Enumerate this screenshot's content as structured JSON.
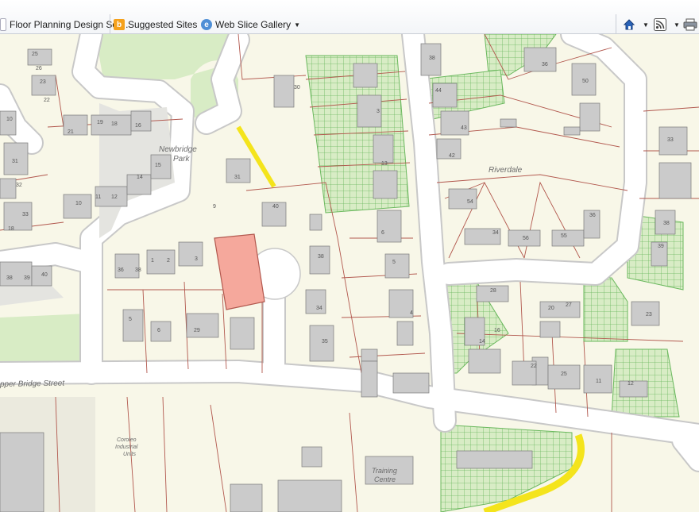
{
  "toolbar": {
    "tab_title": "Floor Planning Design Sof...",
    "suggested_sites": "Suggested Sites",
    "web_slice_gallery": "Web Slice Gallery"
  },
  "map": {
    "labels": {
      "newbridge_1": "Newbridge",
      "newbridge_2": "Park",
      "riverdale": "Riverdale",
      "street": "pper Bridge Street",
      "industrial_1": "Coroleo",
      "industrial_2": "Industrial",
      "industrial_3": "Units",
      "training_1": "Training",
      "training_2": "Centre"
    },
    "house_numbers": [
      "25",
      "26",
      "23",
      "22",
      "10",
      "21",
      "19",
      "18",
      "16",
      "31",
      "32",
      "15",
      "14",
      "12",
      "11",
      "10",
      "9",
      "33",
      "18",
      "38",
      "39",
      "40",
      "36",
      "38",
      "1",
      "2",
      "3",
      "5",
      "6",
      "29",
      "30",
      "31",
      "40",
      "38",
      "34",
      "35",
      "38",
      "36",
      "50",
      "44",
      "43",
      "42",
      "33",
      "54",
      "34",
      "56",
      "55",
      "36",
      "38",
      "39",
      "28",
      "27",
      "20",
      "23",
      "22",
      "25",
      "11",
      "12",
      "16",
      "14",
      "13",
      "6",
      "5",
      "4",
      "3"
    ],
    "colors": {
      "land": "#f8f7e8",
      "road": "#ffffff",
      "road_edge": "#c8c8c8",
      "parcel_line": "#b2584e",
      "building": "#cbcbcb",
      "green_area": "#d8ecc5",
      "green_hatch": "#6ab85d",
      "yellow": "#f4e41c",
      "highlight_plot": "#f5a89c"
    }
  }
}
